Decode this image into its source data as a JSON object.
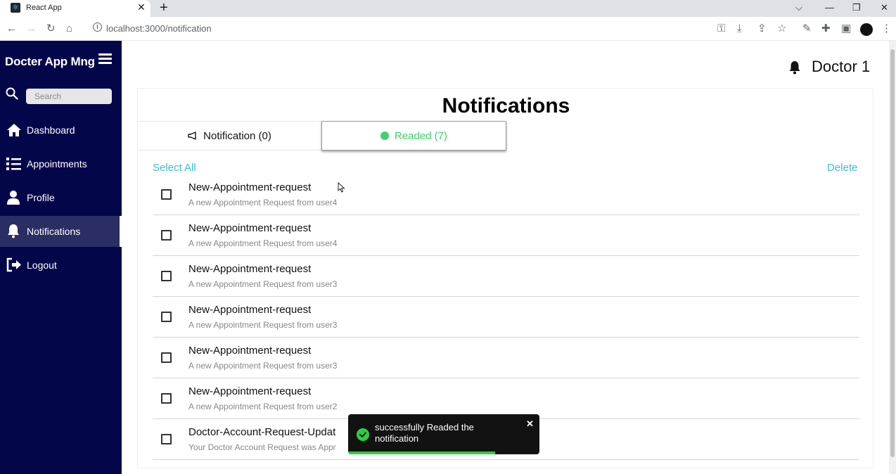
{
  "browser": {
    "tab_title": "React App",
    "url": "localhost:3000/notification",
    "new_tab": "+",
    "tab_close": "✕"
  },
  "sidebar": {
    "brand": "Docter App Mng",
    "search_placeholder": "Search",
    "items": [
      {
        "label": "Dashboard",
        "icon": "home-icon"
      },
      {
        "label": "Appointments",
        "icon": "list-icon"
      },
      {
        "label": "Profile",
        "icon": "user-icon"
      },
      {
        "label": "Notifications",
        "icon": "bell-icon",
        "active": true
      },
      {
        "label": "Logout",
        "icon": "logout-icon"
      }
    ]
  },
  "header": {
    "user_name": "Doctor 1"
  },
  "page": {
    "title": "Notifications",
    "tabs": {
      "notification": "Notification (0)",
      "readed": "Readed (7)"
    },
    "select_all": "Select All",
    "delete": "Delete",
    "notifications": [
      {
        "title": "New-Appointment-request",
        "desc": "A new Appointment Request from user4"
      },
      {
        "title": "New-Appointment-request",
        "desc": "A new Appointment Request from user4"
      },
      {
        "title": "New-Appointment-request",
        "desc": "A new Appointment Request from user3"
      },
      {
        "title": "New-Appointment-request",
        "desc": "A new Appointment Request from user3"
      },
      {
        "title": "New-Appointment-request",
        "desc": "A new Appointment Request from user3"
      },
      {
        "title": "New-Appointment-request",
        "desc": "A new Appointment Request from user2"
      },
      {
        "title": "Doctor-Account-Request-Updat",
        "desc": "Your Doctor Account Request was Appr"
      }
    ]
  },
  "toast": {
    "message": "successfully Readed the notification",
    "close": "✕",
    "progress": 0.77
  },
  "colors": {
    "sidebar_bg": "#03074a",
    "accent_link": "#3bbfd1",
    "readed_green": "#3dd36b",
    "toast_bg": "#121212"
  }
}
